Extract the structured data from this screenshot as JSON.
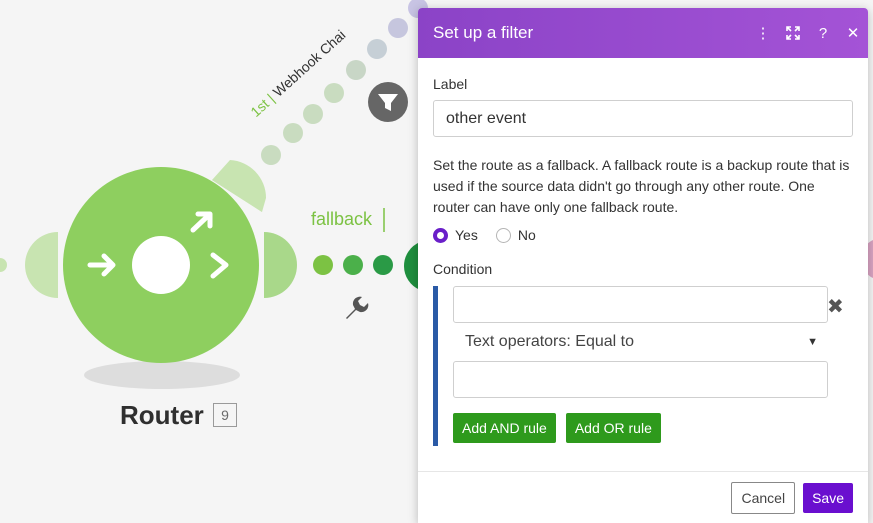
{
  "canvas": {
    "router": {
      "label": "Router",
      "badge": "9"
    },
    "fallback_route_label": "fallback",
    "first_route": {
      "order": "1st",
      "name": "Webhook Chai"
    }
  },
  "panel": {
    "title": "Set up a filter",
    "header_icons": [
      "more-vertical-icon",
      "expand-icon",
      "help-icon",
      "close-icon"
    ],
    "label_field": {
      "label": "Label",
      "value": "other event"
    },
    "fallback_description": "Set the route as a fallback. A fallback route is a backup route that is used if the source data didn't go through any other route. One router can have only one fallback route.",
    "fallback_options": {
      "yes": "Yes",
      "no": "No",
      "selected": "yes"
    },
    "condition": {
      "label": "Condition",
      "operand_a": "",
      "operator": "Text operators: Equal to",
      "operand_b": ""
    },
    "add_and_rule": "Add AND rule",
    "add_or_rule": "Add OR rule",
    "cancel": "Cancel",
    "save": "Save"
  },
  "colors": {
    "router_green": "#8ecf5f",
    "route_green": "#7cc243",
    "panel_header": "#9b4fd0",
    "save_purple": "#6a0fcf",
    "rule_green": "#2e9a1c",
    "condition_bar": "#2a5aa6"
  }
}
